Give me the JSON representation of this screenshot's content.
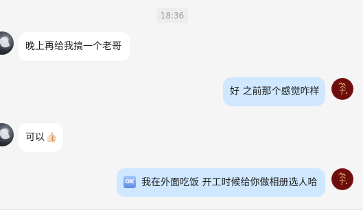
{
  "timestamp": "18:36",
  "messages": [
    {
      "side": "left",
      "text": "晚上再给我搞一个老哥"
    },
    {
      "side": "right",
      "text": "好 之前那个感觉咋样"
    },
    {
      "side": "left",
      "text": "可以",
      "emoji": "👍🏻"
    },
    {
      "side": "right",
      "prefix_emoji": "OK",
      "text": "我在外面吃饭 开工时候给你做相册选人哈"
    }
  ],
  "colors": {
    "background": "#f5f5f5",
    "left_bubble": "#ffffff",
    "right_bubble": "#cfe8ff",
    "right_avatar": "#6f0d0d",
    "timestamp": "#9a9a9a"
  },
  "icons": {
    "left_avatar": "contact-avatar",
    "right_avatar": "seal-avatar",
    "ok_emoji": "ok-emoji",
    "thumb_emoji": "thumbs-up-emoji"
  }
}
